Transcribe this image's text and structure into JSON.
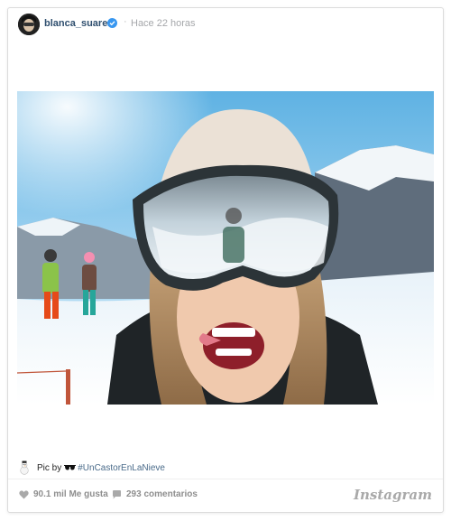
{
  "post": {
    "username": "blanca_suarez",
    "separator": "·",
    "time": "Hace 22 horas"
  },
  "caption": {
    "prefix": "Pic by",
    "hashtag": "#UnCastorEnLaNieve"
  },
  "footer": {
    "likes": "90.1 mil Me gusta",
    "comments": "293 comentarios",
    "brand": "Instagram"
  },
  "icons": {
    "verified": "verified-badge-icon",
    "like": "heart-icon",
    "comment": "speech-bubble-icon",
    "snowman": "snowman-emoji",
    "sunglasses": "sunglasses-emoji"
  },
  "colors": {
    "username": "#2e4e6e",
    "verified": "#3897f0",
    "meta_gray": "#8e8e8e",
    "hashtag": "#4a6b8a"
  }
}
